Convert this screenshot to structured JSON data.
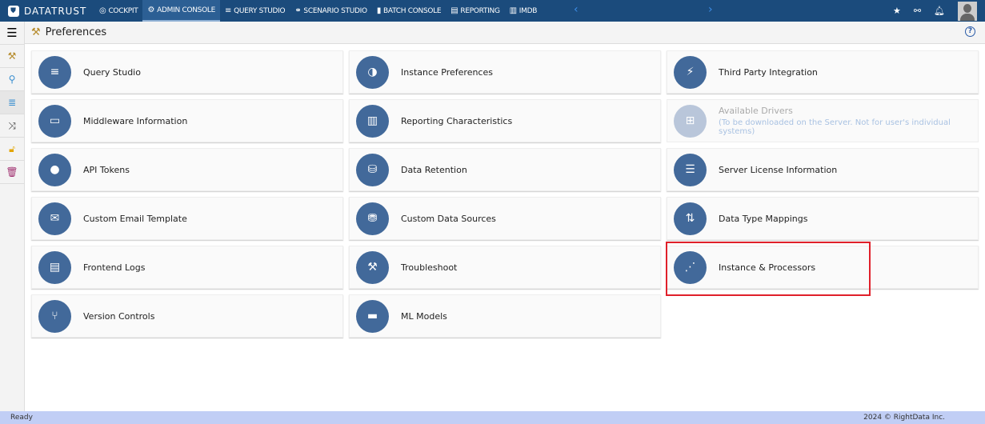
{
  "app": {
    "name": "DATATRUST"
  },
  "nav": [
    {
      "label": "COCKPIT",
      "icon": "gauge-icon",
      "glyph": "◎"
    },
    {
      "label": "ADMIN CONSOLE",
      "icon": "gear-icon",
      "glyph": "⚙",
      "active": true
    },
    {
      "label": "QUERY STUDIO",
      "icon": "database-icon",
      "glyph": "≡"
    },
    {
      "label": "SCENARIO STUDIO",
      "icon": "scenario-icon",
      "glyph": "⚭"
    },
    {
      "label": "BATCH CONSOLE",
      "icon": "batch-icon",
      "glyph": "▮"
    },
    {
      "label": "REPORTING",
      "icon": "report-icon",
      "glyph": "▤"
    },
    {
      "label": "IMDB",
      "icon": "imdb-icon",
      "glyph": "▥"
    }
  ],
  "header": {
    "title": "Preferences"
  },
  "sidebar": [
    "tools-icon",
    "hierarchy-icon",
    "database-icon",
    "shuffle-icon",
    "unlock-icon",
    "trash-icon"
  ],
  "cards": [
    {
      "label": "Query Studio",
      "icon": "database-icon",
      "glyph": "≡"
    },
    {
      "label": "Instance Preferences",
      "icon": "contrast-icon",
      "glyph": "◑"
    },
    {
      "label": "Third Party Integration",
      "icon": "plug-icon",
      "glyph": "⚡"
    },
    {
      "label": "Middleware Information",
      "icon": "monitor-icon",
      "glyph": "▭"
    },
    {
      "label": "Reporting Characteristics",
      "icon": "bar-chart-icon",
      "glyph": "▥"
    },
    {
      "label": "Available Drivers",
      "sub": "(To be downloaded on the Server. Not for user's individual systems)",
      "icon": "windows-icon",
      "glyph": "⊞",
      "disabled": true
    },
    {
      "label": "API Tokens",
      "icon": "globe-icon",
      "glyph": "●"
    },
    {
      "label": "Data Retention",
      "icon": "retention-icon",
      "glyph": "⛁"
    },
    {
      "label": "Server License Information",
      "icon": "server-icon",
      "glyph": "☰"
    },
    {
      "label": "Custom Email Template",
      "icon": "envelope-icon",
      "glyph": "✉"
    },
    {
      "label": "Custom Data Sources",
      "icon": "data-source-icon",
      "glyph": "⛃"
    },
    {
      "label": "Data Type Mappings",
      "icon": "mapping-icon",
      "glyph": "⇅"
    },
    {
      "label": "Frontend Logs",
      "icon": "document-icon",
      "glyph": "▤"
    },
    {
      "label": "Troubleshoot",
      "icon": "tools-icon",
      "glyph": "⚒"
    },
    {
      "label": "Instance & Processors",
      "icon": "processors-icon",
      "glyph": "⋰"
    },
    {
      "label": "Version Controls",
      "icon": "branch-icon",
      "glyph": "⑂"
    },
    {
      "label": "ML Models",
      "icon": "file-icon",
      "glyph": "▬"
    }
  ],
  "status": {
    "left": "Ready",
    "right": "2024 © RightData Inc."
  },
  "colors": {
    "topbar": "#1b4b7c",
    "icon_circle": "#42699a",
    "highlight": "#e0202a",
    "statusbar": "#c1cef5"
  }
}
